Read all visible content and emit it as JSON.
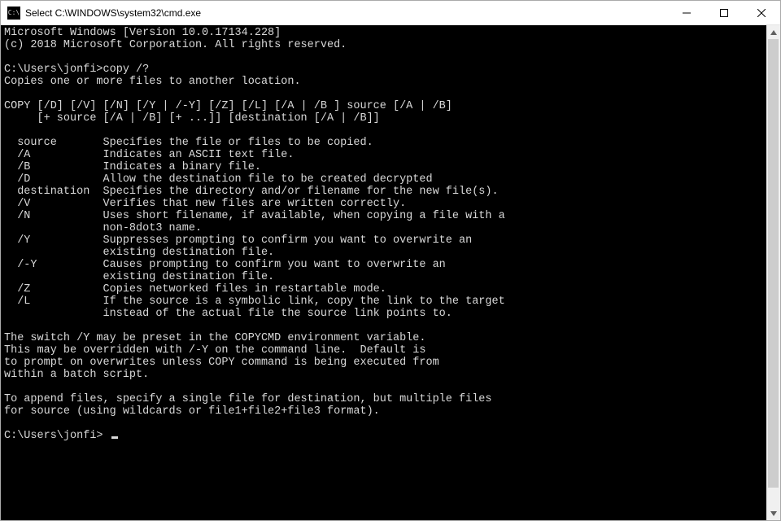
{
  "window": {
    "title": "Select C:\\WINDOWS\\system32\\cmd.exe"
  },
  "terminal": {
    "line01": "Microsoft Windows [Version 10.0.17134.228]",
    "line02": "(c) 2018 Microsoft Corporation. All rights reserved.",
    "line03": "",
    "line04": "C:\\Users\\jonfi>copy /?",
    "line05": "Copies one or more files to another location.",
    "line06": "",
    "line07": "COPY [/D] [/V] [/N] [/Y | /-Y] [/Z] [/L] [/A | /B ] source [/A | /B]",
    "line08": "     [+ source [/A | /B] [+ ...]] [destination [/A | /B]]",
    "line09": "",
    "line10": "  source       Specifies the file or files to be copied.",
    "line11": "  /A           Indicates an ASCII text file.",
    "line12": "  /B           Indicates a binary file.",
    "line13": "  /D           Allow the destination file to be created decrypted",
    "line14": "  destination  Specifies the directory and/or filename for the new file(s).",
    "line15": "  /V           Verifies that new files are written correctly.",
    "line16": "  /N           Uses short filename, if available, when copying a file with a",
    "line17": "               non-8dot3 name.",
    "line18": "  /Y           Suppresses prompting to confirm you want to overwrite an",
    "line19": "               existing destination file.",
    "line20": "  /-Y          Causes prompting to confirm you want to overwrite an",
    "line21": "               existing destination file.",
    "line22": "  /Z           Copies networked files in restartable mode.",
    "line23": "  /L           If the source is a symbolic link, copy the link to the target",
    "line24": "               instead of the actual file the source link points to.",
    "line25": "",
    "line26": "The switch /Y may be preset in the COPYCMD environment variable.",
    "line27": "This may be overridden with /-Y on the command line.  Default is",
    "line28": "to prompt on overwrites unless COPY command is being executed from",
    "line29": "within a batch script.",
    "line30": "",
    "line31": "To append files, specify a single file for destination, but multiple files",
    "line32": "for source (using wildcards or file1+file2+file3 format).",
    "line33": "",
    "prompt": "C:\\Users\\jonfi> "
  }
}
